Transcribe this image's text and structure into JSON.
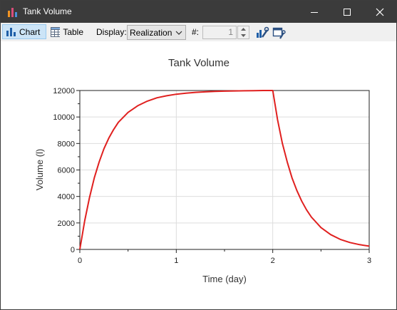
{
  "window": {
    "title": "Tank Volume"
  },
  "toolbar": {
    "chart_label": "Chart",
    "table_label": "Table",
    "display_label": "Display:",
    "display_value": "Realization",
    "number_label": "#:",
    "number_value": "1"
  },
  "colors": {
    "titlebar": "#3b3b3b",
    "series": "#e0201f",
    "active_button": "#cce4f7"
  },
  "chart_data": {
    "type": "line",
    "title": "Tank Volume",
    "xlabel": "Time (day)",
    "ylabel": "Volume (l)",
    "xlim": [
      0,
      3
    ],
    "ylim": [
      0,
      12000
    ],
    "x_ticks": [
      "0",
      "1",
      "2",
      "3"
    ],
    "y_ticks": [
      "0",
      "2000",
      "4000",
      "6000",
      "8000",
      "10000",
      "12000"
    ],
    "grid": true,
    "series": [
      {
        "color": "#e0201f",
        "x": [
          0,
          0.05,
          0.1,
          0.15,
          0.2,
          0.25,
          0.3,
          0.35,
          0.4,
          0.5,
          0.6,
          0.7,
          0.8,
          0.9,
          1.0,
          1.1,
          1.2,
          1.3,
          1.4,
          1.5,
          1.6,
          1.7,
          1.8,
          1.9,
          2.0,
          2.05,
          2.1,
          2.15,
          2.2,
          2.25,
          2.3,
          2.35,
          2.4,
          2.5,
          2.6,
          2.7,
          2.8,
          2.9,
          3.0
        ],
        "y": [
          0,
          2150,
          3900,
          5400,
          6600,
          7600,
          8400,
          9050,
          9600,
          10350,
          10850,
          11200,
          11450,
          11600,
          11720,
          11800,
          11860,
          11900,
          11930,
          11950,
          11970,
          11980,
          11990,
          12000,
          12000,
          9800,
          8000,
          6600,
          5400,
          4450,
          3650,
          3000,
          2450,
          1650,
          1120,
          760,
          520,
          360,
          250
        ]
      }
    ]
  }
}
